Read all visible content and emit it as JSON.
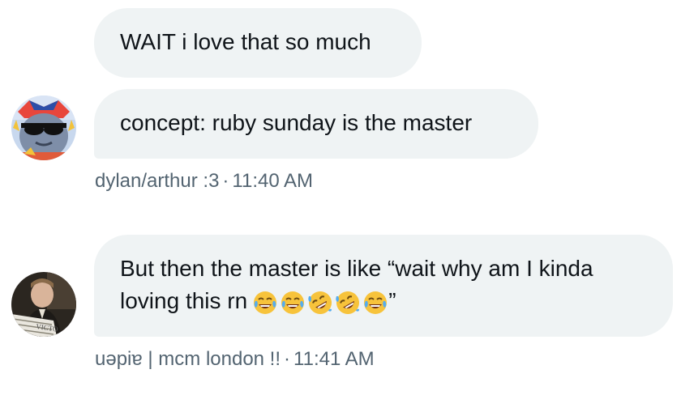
{
  "messages": [
    {
      "text": "WAIT i love that so much"
    },
    {
      "text": "concept: ruby sunday is the master",
      "sender": "dylan/arthur :3",
      "time": "11:40 AM"
    },
    {
      "text_line1": "But then the master is like “wait why am I kinda",
      "text_line2": "loving this rn",
      "emojis": [
        "joy-emoji",
        "joy-emoji",
        "rofl-emoji",
        "rofl-emoji",
        "joy-emoji"
      ],
      "closing_quote": "”",
      "sender": "uəpiɐ | mcm london !!",
      "time": "11:41 AM"
    }
  ],
  "separator": "·",
  "avatar_icons": [
    "cartoon-character-sunglasses-avatar",
    "newspaper-man-avatar"
  ],
  "colors": {
    "bubble_bg": "#eff3f4",
    "text": "#0f1419",
    "meta": "#536471",
    "page_bg": "#ffffff"
  }
}
